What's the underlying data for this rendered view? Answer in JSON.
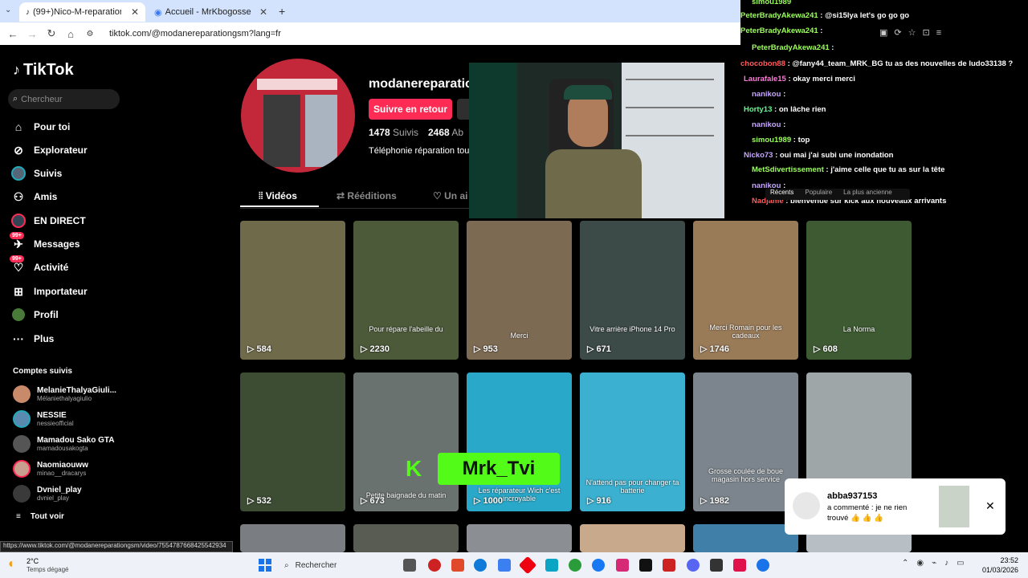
{
  "browser": {
    "tabs": [
      {
        "label": "(99+)Nico-M-reparation-gsm (",
        "active": true
      },
      {
        "label": "Accueil - MrKbogosse",
        "active": false
      }
    ],
    "url": "tiktok.com/@modanereparationgsm?lang=fr"
  },
  "sidebar": {
    "logo": "TikTok",
    "search_placeholder": "Chercheur",
    "items": [
      {
        "label": "Pour toi",
        "icon": "home-icon"
      },
      {
        "label": "Explorateur",
        "icon": "compass-icon"
      },
      {
        "label": "Suivis",
        "icon": "following-icon"
      },
      {
        "label": "Amis",
        "icon": "friends-icon"
      },
      {
        "label": "EN DIRECT",
        "icon": "live-icon"
      },
      {
        "label": "Messages",
        "icon": "messages-icon",
        "badge": "99+"
      },
      {
        "label": "Activité",
        "icon": "activity-icon",
        "badge": "99+"
      },
      {
        "label": "Importateur",
        "icon": "upload-icon"
      },
      {
        "label": "Profil",
        "icon": "profile-icon"
      },
      {
        "label": "Plus",
        "icon": "more-icon"
      }
    ],
    "followed_title": "Comptes suivis",
    "followed": [
      {
        "name": "MelanieThalyaGiuli...",
        "user": "Mélaniethalyagiulio"
      },
      {
        "name": "NESSIE",
        "user": "nessieofficial"
      },
      {
        "name": "Mamadou Sako GTA",
        "user": "mamadousakogta"
      },
      {
        "name": "Naomiaouww",
        "user": "minao__dracarys"
      },
      {
        "name": "Dvniel_play",
        "user": "dvniel_play"
      }
    ],
    "see_all": "Tout voir"
  },
  "profile": {
    "username": "modanereparatio",
    "follow_back": "Suivre en retour",
    "following_count": "1478",
    "following_label": "Suivis",
    "followers_count": "2468",
    "followers_label": "Ab",
    "bio": "Téléphonie réparation tou",
    "tabs": [
      {
        "label": "Vidéos",
        "active": true
      },
      {
        "label": "Rééditions",
        "active": false
      },
      {
        "label": "Un ai",
        "active": false
      }
    ]
  },
  "videos": [
    {
      "caption": "",
      "views": "584"
    },
    {
      "caption": "Pour répare l'abeille du",
      "views": "2230"
    },
    {
      "caption": "Merci",
      "views": "953"
    },
    {
      "caption": "Vitre arrière iPhone 14 Pro",
      "views": "671"
    },
    {
      "caption": "Merci Romain pour les cadeaux",
      "views": "1746"
    },
    {
      "caption": "La Norma",
      "views": "608"
    },
    {
      "caption": "",
      "views": "532"
    },
    {
      "caption": "Petite baignade du matin",
      "views": "673"
    },
    {
      "caption": "Les réparateur Wich c'est incroyable",
      "views": "1000"
    },
    {
      "caption": "N'attend pas pour changer ta batterie",
      "views": "916"
    },
    {
      "caption": "Grosse coulée de boue magasin hors service",
      "views": "1982"
    },
    {
      "caption": "",
      "views": ""
    }
  ],
  "overlay": {
    "kick_text": "Mrk_Tvi"
  },
  "chat": {
    "lines": [
      {
        "user": "simou1989",
        "text": "",
        "color": "#9bff5a"
      },
      {
        "user": "PeterBradyAkewa241",
        "text": ": @si15lya let's go go go",
        "color": "#9bff5a"
      },
      {
        "user": "PeterBradyAkewa241",
        "text": ":",
        "color": "#9bff5a"
      },
      {
        "user": "PeterBradyAkewa241",
        "text": ":",
        "color": "#9bff5a"
      },
      {
        "user": "chocobon88",
        "text": ": @fany44_team_MRK_BG tu as des nouvelles de ludo33138 ?",
        "color": "#ff5c5c"
      },
      {
        "user": "Laurafale15",
        "text": ": okay merci merci",
        "color": "#ff7ad9"
      },
      {
        "user": "nanikou",
        "text": ":",
        "color": "#c6a6ff"
      },
      {
        "user": "Horty13",
        "text": ": on lâche rien",
        "color": "#5cff8a"
      },
      {
        "user": "nanikou",
        "text": ":",
        "color": "#c6a6ff"
      },
      {
        "user": "simou1989",
        "text": ": top",
        "color": "#9bff5a"
      },
      {
        "user": "Nicko73",
        "text": ": oui mai j'ai subi une inondation",
        "color": "#c6a6ff"
      },
      {
        "user": "MetSdivertissement",
        "text": ": j'aime celle que tu as sur la tête",
        "color": "#9bff5a"
      },
      {
        "user": "nanikou",
        "text": ":",
        "color": "#c6a6ff"
      },
      {
        "user": "Nadjamé",
        "text": ": bienvenue sur kick aux nouveaux arrivants",
        "color": "#ff5c5c"
      }
    ],
    "sort_options": [
      "Récents",
      "Populaire",
      "La plus ancienne"
    ]
  },
  "notification": {
    "user": "abba937153",
    "text": "a commenté : je ne rien trouvé 👍 👍 👍"
  },
  "status_url": "https://www.tiktok.com/@modanereparationgsm/video/7554787668425542934",
  "taskbar": {
    "weather_temp": "2°C",
    "weather_desc": "Temps dégagé",
    "search": "Rechercher",
    "time": "23:52",
    "date": "01/03/2026"
  },
  "colors": {
    "accent": "#fe2c55",
    "tab_bg": "#d3e3fd"
  }
}
